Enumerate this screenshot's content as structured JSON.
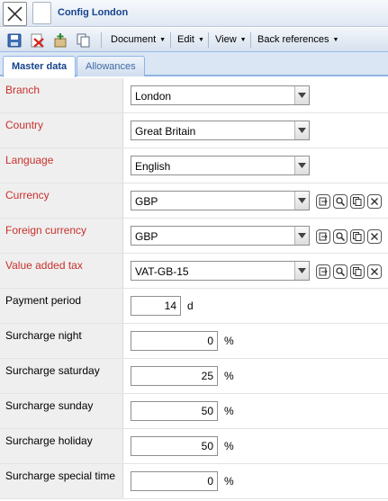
{
  "window": {
    "title": "Config London",
    "close_icon": "close-x-icon"
  },
  "toolbar": {
    "icons": [
      "save-icon",
      "delete-icon",
      "new-record-icon",
      "copy-icon"
    ],
    "menus": [
      {
        "label": "Document"
      },
      {
        "label": "Edit"
      },
      {
        "label": "View"
      },
      {
        "label": "Back references"
      }
    ]
  },
  "tabs": [
    {
      "label": "Master data",
      "active": true
    },
    {
      "label": "Allowances",
      "active": false
    }
  ],
  "fields": {
    "branch": {
      "label": "Branch",
      "value": "London",
      "required": true
    },
    "country": {
      "label": "Country",
      "value": "Great Britain",
      "required": true
    },
    "language": {
      "label": "Language",
      "value": "English",
      "required": true
    },
    "currency": {
      "label": "Currency",
      "value": "GBP",
      "required": true
    },
    "foreign_currency": {
      "label": "Foreign currency",
      "value": "GBP",
      "required": true
    },
    "vat": {
      "label": "Value added tax",
      "value": "VAT-GB-15",
      "required": true
    },
    "payment_period": {
      "label": "Payment period",
      "value": "14",
      "unit": "d"
    },
    "surcharge_night": {
      "label": "Surcharge night",
      "value": "0",
      "unit": "%"
    },
    "surcharge_saturday": {
      "label": "Surcharge saturday",
      "value": "25",
      "unit": "%"
    },
    "surcharge_sunday": {
      "label": "Surcharge sunday",
      "value": "50",
      "unit": "%"
    },
    "surcharge_holiday": {
      "label": "Surcharge holiday",
      "value": "50",
      "unit": "%"
    },
    "surcharge_special": {
      "label": "Surcharge special time",
      "value": "0",
      "unit": "%"
    }
  },
  "row_actions": [
    "open-record-icon",
    "lookup-search-icon",
    "copy-record-icon",
    "clear-icon"
  ],
  "colors": {
    "required_label": "#c8312c",
    "title": "#15428b",
    "label_bg": "#efefef"
  }
}
